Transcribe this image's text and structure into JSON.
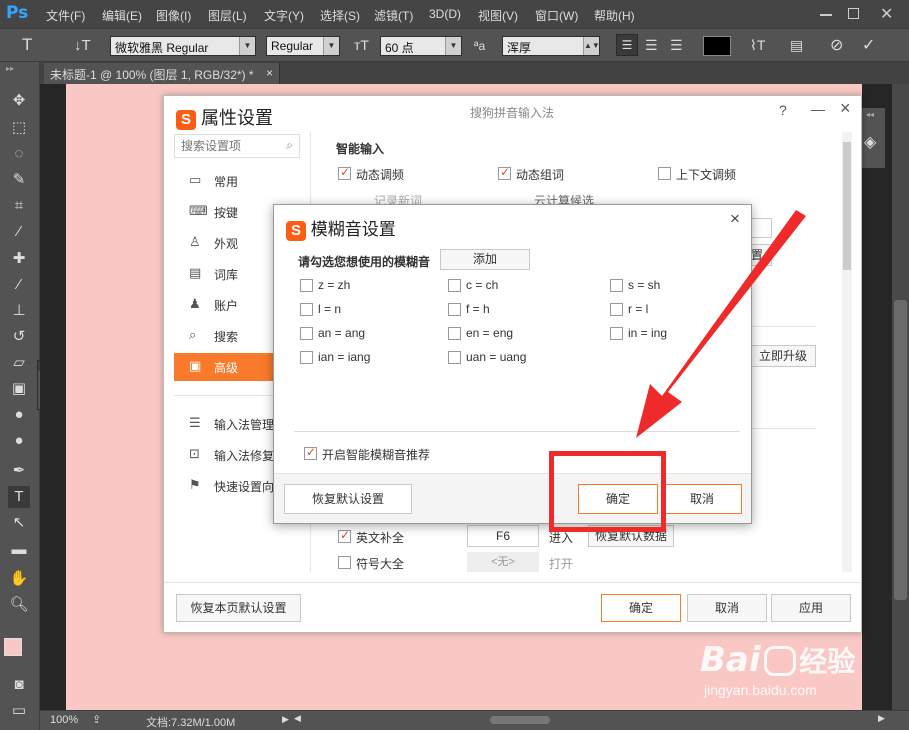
{
  "app": {
    "logo": "Ps",
    "menu": [
      "文件(F)",
      "编辑(E)",
      "图像(I)",
      "图层(L)",
      "文字(Y)",
      "选择(S)",
      "滤镜(T)",
      "3D(D)",
      "视图(V)",
      "窗口(W)",
      "帮助(H)"
    ]
  },
  "options": {
    "font_family": "微软雅黑 Regular",
    "font_style": "Regular",
    "font_size": "60 点",
    "anti_alias": "浑厚",
    "aa_label": "ªa"
  },
  "document": {
    "tab_title": "未标题-1 @ 100% (图层 1, RGB/32*) *",
    "tab_close": "×"
  },
  "status": {
    "zoom": "100%",
    "doc_info": "文档:7.32M/1.00M"
  },
  "props": {
    "title": "属性设置",
    "subtitle": "搜狗拼音输入法",
    "help": "?",
    "minimize": "—",
    "close": "×",
    "search_placeholder": "搜索设置项",
    "nav": [
      {
        "label": "常用",
        "icon": "monitor-icon"
      },
      {
        "label": "按键",
        "icon": "keyboard-icon"
      },
      {
        "label": "外观",
        "icon": "shirt-icon"
      },
      {
        "label": "词库",
        "icon": "book-icon"
      },
      {
        "label": "账户",
        "icon": "user-icon"
      },
      {
        "label": "搜索",
        "icon": "search-icon"
      },
      {
        "label": "高级",
        "icon": "advanced-icon"
      }
    ],
    "nav2": [
      {
        "label": "输入法管理"
      },
      {
        "label": "输入法修复"
      },
      {
        "label": "快速设置向"
      }
    ],
    "section": "智能输入",
    "opts": [
      {
        "label": "动态调频",
        "checked": true
      },
      {
        "label": "动态组词",
        "checked": true
      },
      {
        "label": "上下文调频",
        "checked": false
      }
    ],
    "opts2": [
      {
        "label": "记录新词"
      },
      {
        "label": "云计算候选"
      }
    ],
    "upgrade_btn": "立即升级",
    "partial_btn": "置",
    "english": "英文补全",
    "english_key": "F6",
    "enter": "进入",
    "restore_data": "恢复默认数据",
    "symbols": "符号大全",
    "symbols_key": "<无>",
    "open": "打开",
    "restore_page": "恢复本页默认设置",
    "ok": "确定",
    "cancel": "取消",
    "apply": "应用"
  },
  "fuzzy": {
    "title": "模糊音设置",
    "close": "×",
    "prompt": "请勾选您想使用的模糊音",
    "add": "添加",
    "col1": [
      "z = zh",
      "l = n",
      "an = ang",
      "ian = iang"
    ],
    "col2": [
      "c = ch",
      "f = h",
      "en = eng",
      "uan = uang"
    ],
    "col3": [
      "s = sh",
      "r = l",
      "in = ing"
    ],
    "smart": "开启智能模糊音推荐",
    "restore": "恢复默认设置",
    "ok": "确定",
    "cancel": "取消"
  },
  "watermark": {
    "brand": "Bai",
    "brand2": "经验",
    "url": "jingyan.baidu.com"
  },
  "colors": {
    "accent": "#fa7a2b",
    "canvas": "#fac8c4",
    "arrow": "#ee2a2a"
  }
}
